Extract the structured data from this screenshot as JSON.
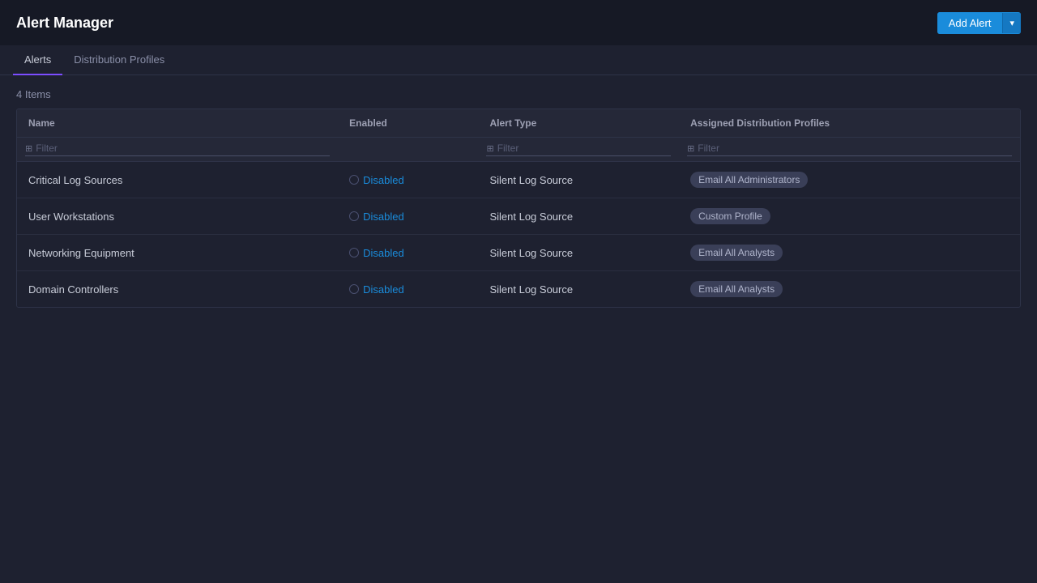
{
  "header": {
    "title": "Alert Manager",
    "add_alert_label": "Add Alert",
    "add_alert_dropdown_icon": "▾"
  },
  "tabs": [
    {
      "id": "alerts",
      "label": "Alerts",
      "active": true
    },
    {
      "id": "distribution-profiles",
      "label": "Distribution Profiles",
      "active": false
    }
  ],
  "main": {
    "item_count": "4 Items",
    "table": {
      "columns": [
        {
          "id": "name",
          "label": "Name"
        },
        {
          "id": "enabled",
          "label": "Enabled"
        },
        {
          "id": "alert_type",
          "label": "Alert Type"
        },
        {
          "id": "dist_profiles",
          "label": "Assigned Distribution Profiles"
        }
      ],
      "filters": [
        {
          "placeholder": "Filter"
        },
        {
          "placeholder": ""
        },
        {
          "placeholder": "Filter"
        },
        {
          "placeholder": "Filter"
        }
      ],
      "rows": [
        {
          "name": "Critical Log Sources",
          "enabled": "Disabled",
          "alert_type": "Silent Log Source",
          "dist_profile": "Email All Administrators"
        },
        {
          "name": "User Workstations",
          "enabled": "Disabled",
          "alert_type": "Silent Log Source",
          "dist_profile": "Custom Profile"
        },
        {
          "name": "Networking Equipment",
          "enabled": "Disabled",
          "alert_type": "Silent Log Source",
          "dist_profile": "Email All Analysts"
        },
        {
          "name": "Domain Controllers",
          "enabled": "Disabled",
          "alert_type": "Silent Log Source",
          "dist_profile": "Email All Analysts"
        }
      ]
    }
  },
  "colors": {
    "accent": "#7c4dff",
    "button_blue": "#1a8cdb",
    "disabled_text": "#1a8cdb"
  }
}
